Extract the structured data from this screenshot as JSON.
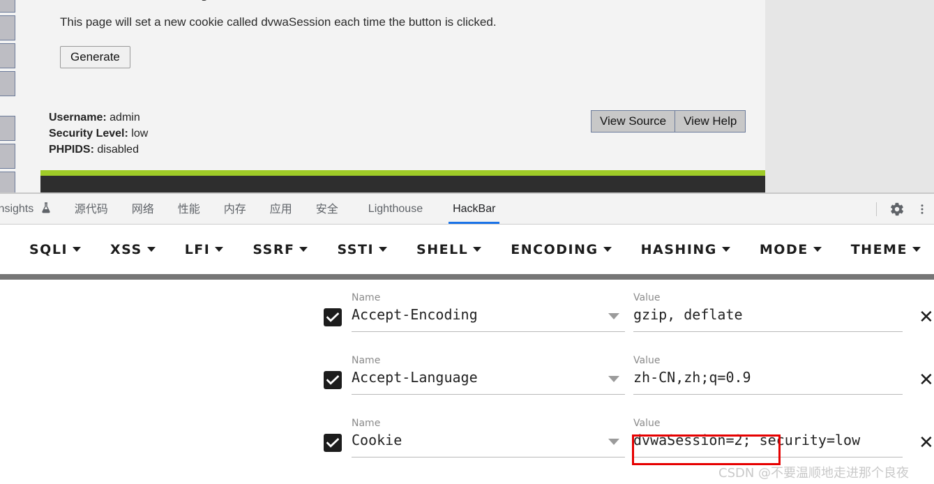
{
  "dvwa": {
    "title_fragment": "y",
    "description": "This page will set a new cookie called dvwaSession each time the button is clicked.",
    "generate_label": "Generate",
    "meta": [
      {
        "label": "Username:",
        "value": "admin"
      },
      {
        "label": "Security Level:",
        "value": "low"
      },
      {
        "label": "PHPIDS:",
        "value": "disabled"
      }
    ],
    "view_source_label": "View Source",
    "view_help_label": "View Help",
    "nav_item_count": 7,
    "accent_green": "#9fcb28",
    "footer_dark": "#2e2e2e"
  },
  "devtools": {
    "tabs": [
      {
        "label": "insights",
        "icon": "flask-icon",
        "active": false,
        "lang": "en"
      },
      {
        "label": "源代码",
        "active": false,
        "lang": "zh"
      },
      {
        "label": "网络",
        "active": false,
        "lang": "zh"
      },
      {
        "label": "性能",
        "active": false,
        "lang": "zh"
      },
      {
        "label": "内存",
        "active": false,
        "lang": "zh"
      },
      {
        "label": "应用",
        "active": false,
        "lang": "zh"
      },
      {
        "label": "安全",
        "active": false,
        "lang": "zh"
      },
      {
        "label": "Lighthouse",
        "active": false,
        "lang": "en"
      },
      {
        "label": "HackBar",
        "active": true,
        "lang": "en"
      }
    ],
    "settings_icon": "gear-icon",
    "more_icon": "more-vertical-icon",
    "active_tab_color": "#1a73e8"
  },
  "hackbar": {
    "menu": [
      {
        "label": "SQLI"
      },
      {
        "label": "XSS"
      },
      {
        "label": "LFI"
      },
      {
        "label": "SSRF"
      },
      {
        "label": "SSTI"
      },
      {
        "label": "SHELL"
      },
      {
        "label": "ENCODING"
      },
      {
        "label": "HASHING"
      },
      {
        "label": "MODE"
      },
      {
        "label": "THEME"
      }
    ],
    "name_label": "Name",
    "value_label": "Value",
    "delete_icon": "close-icon",
    "rows": [
      {
        "checked": true,
        "name": "Accept-Encoding",
        "value": "gzip, deflate"
      },
      {
        "checked": true,
        "name": "Accept-Language",
        "value": "zh-CN,zh;q=0.9"
      },
      {
        "checked": true,
        "name": "Cookie",
        "value": "dvwaSession=2; security=low"
      }
    ]
  },
  "annotation": {
    "highlight_text": "dvwaSession=2;",
    "color": "#e60000"
  },
  "watermark": {
    "text": "CSDN @不要温顺地走进那个良夜"
  }
}
